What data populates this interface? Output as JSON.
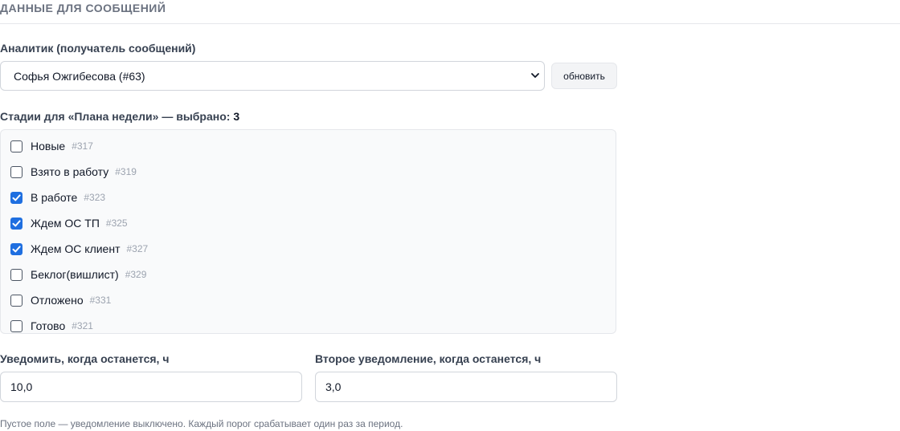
{
  "section": {
    "title": "ДАННЫЕ ДЛЯ СООБЩЕНИЙ"
  },
  "analyst": {
    "label": "Аналитик (получатель сообщений)",
    "selected": "Софья Ожгибесова (#63)",
    "refresh_label": "обновить"
  },
  "stages": {
    "label_prefix": "Стадии для «Плана недели» — выбрано: ",
    "selected_count": "3",
    "items": [
      {
        "name": "Новые",
        "id": "#317",
        "checked": false
      },
      {
        "name": "Взято в работу",
        "id": "#319",
        "checked": false
      },
      {
        "name": "В работе",
        "id": "#323",
        "checked": true
      },
      {
        "name": "Ждем ОС ТП",
        "id": "#325",
        "checked": true
      },
      {
        "name": "Ждем ОС клиент",
        "id": "#327",
        "checked": true
      },
      {
        "name": "Беклог(вишлист)",
        "id": "#329",
        "checked": false
      },
      {
        "name": "Отложено",
        "id": "#331",
        "checked": false
      },
      {
        "name": "Готово",
        "id": "#321",
        "checked": false
      }
    ]
  },
  "notify": {
    "first_label": "Уведомить, когда останется, ч",
    "first_value": "10,0",
    "second_label": "Второе уведомление, когда останется, ч",
    "second_value": "3,0",
    "hint": "Пустое поле — уведомление выключено. Каждый порог срабатывает один раз за период."
  },
  "colors": {
    "accent": "#1f6fe0",
    "muted": "#9ca3af"
  }
}
